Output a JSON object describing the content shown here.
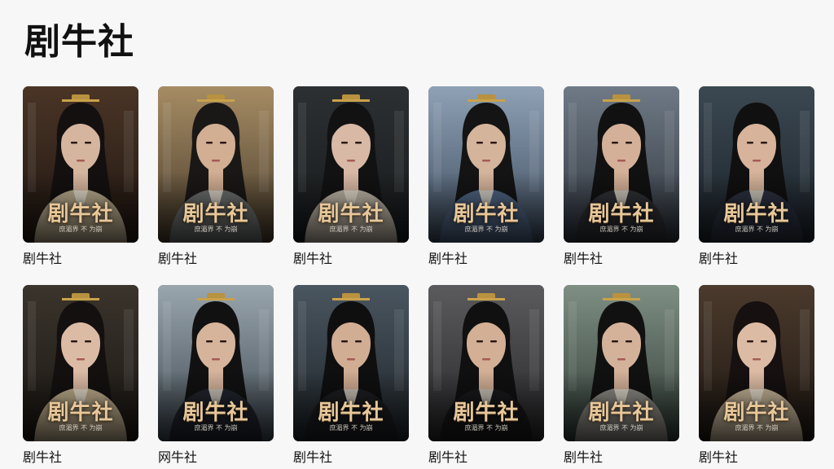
{
  "header": {
    "title": "剧牛社"
  },
  "cards": [
    {
      "title": "剧牛社",
      "poster_text": "剧牛社",
      "poster_subtitle": "庶湄界 不 为崩",
      "bg": "#4a3526",
      "bg2": "#1f1510",
      "cloth": "#b9ab8d",
      "hair": "#141010",
      "skin": "#d6b59e",
      "crown": true
    },
    {
      "title": "剧牛社",
      "poster_text": "剧牛社",
      "poster_subtitle": "庶湄界 不 为崩",
      "bg": "#a68c64",
      "bg2": "#463a2a",
      "cloth": "#6b6e6c",
      "hair": "#1a1816",
      "skin": "#d2ae92",
      "crown": true
    },
    {
      "title": "剧牛社",
      "poster_text": "剧牛社",
      "poster_subtitle": "庶湄界 不 为崩",
      "bg": "#2d3032",
      "bg2": "#16191b",
      "cloth": "#bfb6a6",
      "hair": "#121212",
      "skin": "#d8b9a5",
      "crown": true
    },
    {
      "title": "剧牛社",
      "poster_text": "剧牛社",
      "poster_subtitle": "庶湄界 不 为崩",
      "bg": "#8fa1b5",
      "bg2": "#3b4a5c",
      "cloth": "#4f6382",
      "hair": "#141414",
      "skin": "#d5b49c",
      "crown": true
    },
    {
      "title": "剧牛社",
      "poster_text": "剧牛社",
      "poster_subtitle": "庶湄界 不 为崩",
      "bg": "#6f7a86",
      "bg2": "#2e343c",
      "cloth": "#2f3035",
      "hair": "#111",
      "skin": "#d3b097",
      "crown": true
    },
    {
      "title": "剧牛社",
      "poster_text": "剧牛社",
      "poster_subtitle": "庶湄界 不 为崩",
      "bg": "#3b4852",
      "bg2": "#1b2229",
      "cloth": "#2b3140",
      "hair": "#101010",
      "skin": "#d6b39a",
      "crown": false
    },
    {
      "title": "剧牛社",
      "poster_text": "剧牛社",
      "poster_subtitle": "庶湄界 不 为崩",
      "bg": "#3a342c",
      "bg2": "#1a1612",
      "cloth": "#bfae8c",
      "hair": "#141010",
      "skin": "#dcbba5",
      "crown": true
    },
    {
      "title": "网牛社",
      "poster_text": "剧牛社",
      "poster_subtitle": "庶湄界 不 为崩",
      "bg": "#9aa6ae",
      "bg2": "#3c464e",
      "cloth": "#22252e",
      "hair": "#111",
      "skin": "#d6b49c",
      "crown": true
    },
    {
      "title": "剧牛社",
      "poster_text": "剧牛社",
      "poster_subtitle": "庶湄界 不 为崩",
      "bg": "#4a5660",
      "bg2": "#1d2328",
      "cloth": "#1d1e22",
      "hair": "#0f0f0f",
      "skin": "#d1ad93",
      "crown": true
    },
    {
      "title": "剧牛社",
      "poster_text": "剧牛社",
      "poster_subtitle": "庶湄界 不 为崩",
      "bg": "#5b5b5e",
      "bg2": "#262628",
      "cloth": "#19191b",
      "hair": "#101010",
      "skin": "#d3af95",
      "crown": true
    },
    {
      "title": "剧牛社",
      "poster_text": "剧牛社",
      "poster_subtitle": "庶湄界 不 为崩",
      "bg": "#7f8f84",
      "bg2": "#2f3b35",
      "cloth": "#8c8a84",
      "hair": "#111",
      "skin": "#d4b29a",
      "crown": true
    },
    {
      "title": "剧牛社",
      "poster_text": "剧牛社",
      "poster_subtitle": "庶湄界 不 为崩",
      "bg": "#4b3a2c",
      "bg2": "#1e1712",
      "cloth": "#c5b397",
      "hair": "#161010",
      "skin": "#dcbba4",
      "crown": false
    }
  ]
}
